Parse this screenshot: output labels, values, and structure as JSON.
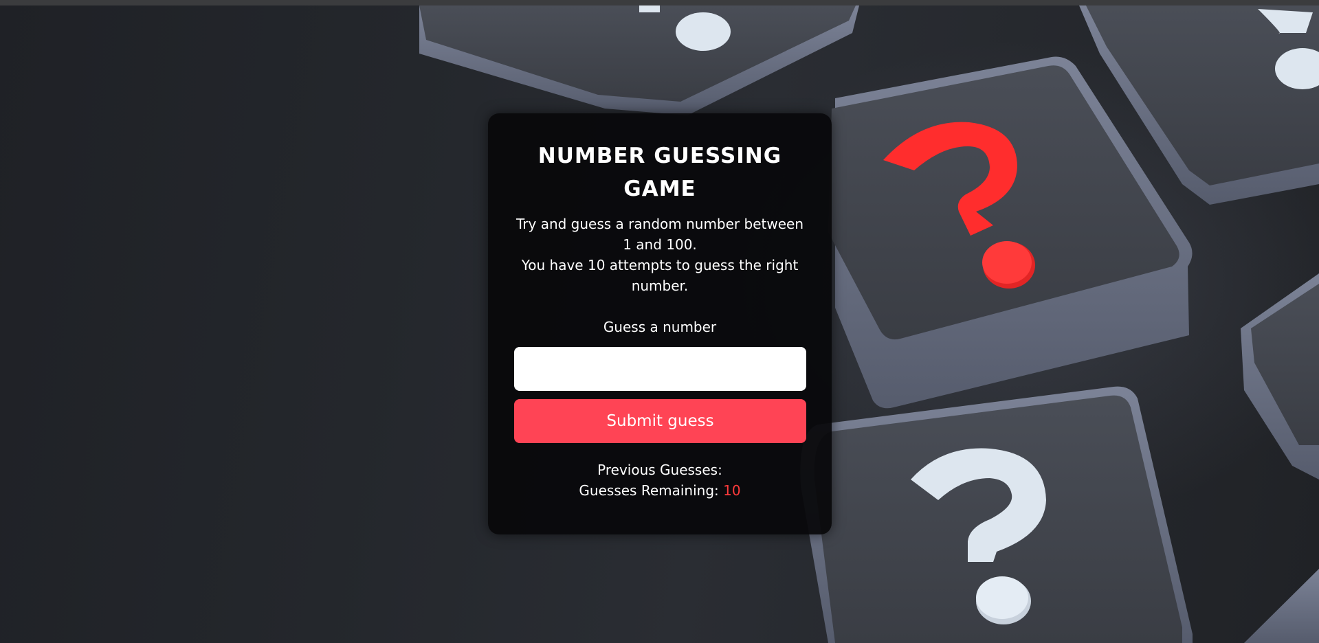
{
  "game": {
    "title": "NUMBER GUESSING GAME",
    "description_line1": "Try and guess a random number between 1 and 100.",
    "description_line2": "You have 10 attempts to guess the right number.",
    "guess_label": "Guess a number",
    "guess_input_value": "",
    "submit_label": "Submit guess",
    "previous_guesses_label": "Previous Guesses:",
    "previous_guesses_value": "",
    "remaining_label": "Guesses Remaining:",
    "remaining_count": "10"
  },
  "background": {
    "description_icons": [
      "question-tile-icon"
    ],
    "accent_color": "#ff2d2d"
  },
  "colors": {
    "card_bg": "#08090b",
    "button_bg": "#ff4455",
    "remaining_count": "#ff3b3b"
  }
}
